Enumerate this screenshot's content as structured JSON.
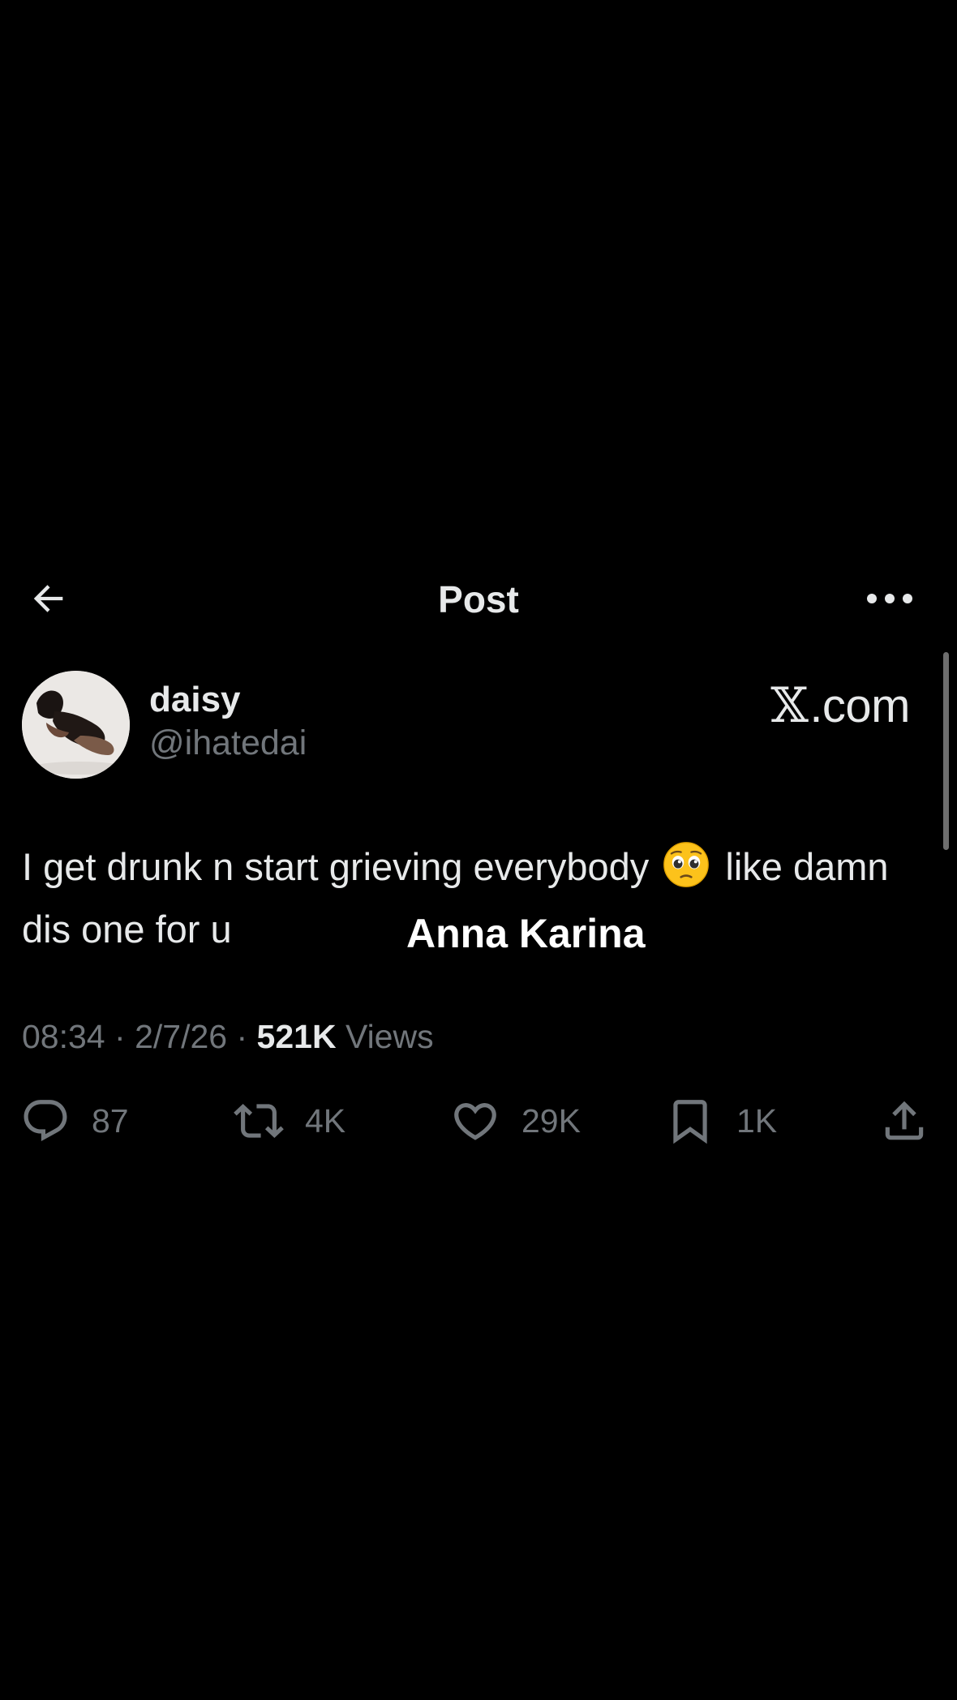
{
  "header": {
    "title": "Post",
    "back_icon": "arrow-left-icon",
    "more_icon": "more-horizontal-icon"
  },
  "author": {
    "display_name": "daisy",
    "handle": "@ihatedai"
  },
  "watermark": {
    "x_glyph": "𝕏",
    "text": ".com"
  },
  "tweet": {
    "text_before_emoji": "I get drunk n start grieving everybody",
    "emoji_name": "pleading-face-emoji",
    "text_after_emoji": "like damn dis one for u",
    "overlay_caption": "Anna Karina"
  },
  "meta": {
    "time": "08:34",
    "separator": "·",
    "date": "2/7/26",
    "views_count": "521K",
    "views_label": "Views"
  },
  "actions": {
    "reply_count": "87",
    "repost_count": "4K",
    "like_count": "29K",
    "bookmark_count": "1K"
  },
  "colors": {
    "background": "#000000",
    "primary_text": "#e7e9ea",
    "secondary_text": "#71767b"
  }
}
